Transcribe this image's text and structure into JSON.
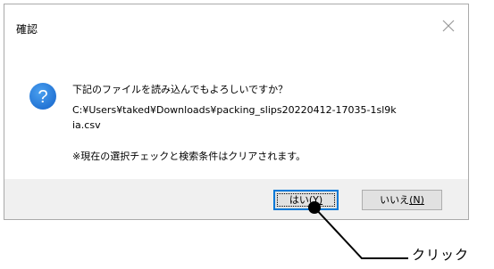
{
  "dialog": {
    "title": "確認",
    "message_line1": "下記のファイルを読み込んでもよろしいですか？",
    "file_path_line1": "C:¥Users¥taked¥Downloads¥packing_slips20220412-17035-1sl9k",
    "file_path_line2": "ia.csv",
    "note": "※現在の選択チェックと検索条件はクリアされます。",
    "icon": "question-icon",
    "close_icon": "close-icon"
  },
  "buttons": {
    "yes_label": "はい",
    "yes_mnemonic": "(Y)",
    "no_label": "いいえ",
    "no_mnemonic": "(N)"
  },
  "annotation": {
    "callout_text": "クリック"
  },
  "colors": {
    "accent": "#0078d7",
    "icon_blue": "#1f6fd1",
    "footer_bg": "#f0f0f0"
  }
}
